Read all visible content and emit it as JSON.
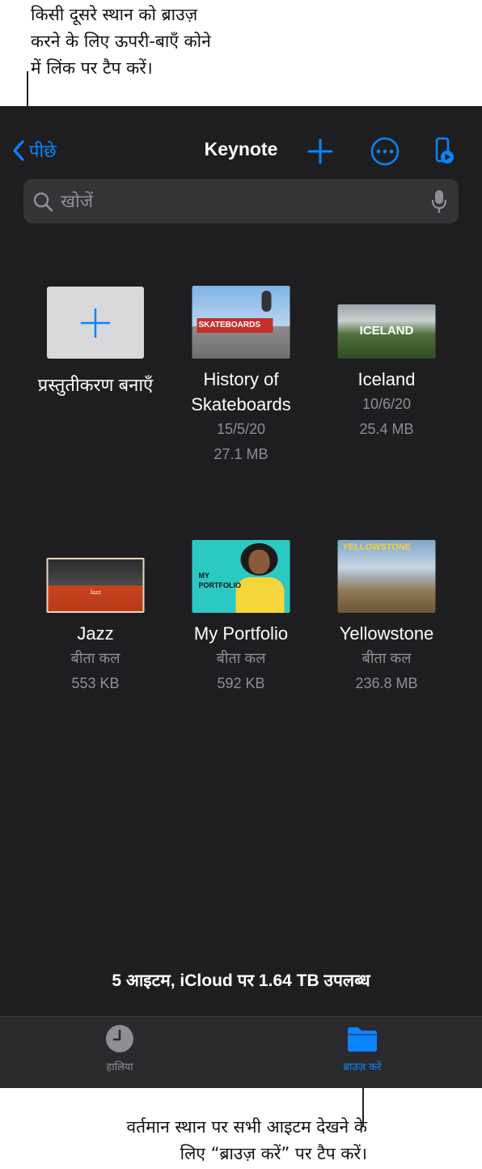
{
  "callouts": {
    "top": "किसी दूसरे स्थान को ब्राउज़\nकरने के लिए ऊपरी-बाएँ कोने\nमें लिंक पर टैप करें।",
    "bottom": "वर्तमान स्थान पर सभी आइटम देखने के\nलिए “ब्राउज़ करें” पर टैप करें।"
  },
  "nav": {
    "back_label": "पीछे",
    "title": "Keynote",
    "icons": [
      "chevron-left-icon",
      "plus-icon",
      "ellipsis-circle-icon",
      "remote-play-icon"
    ]
  },
  "search": {
    "placeholder": "खोजें"
  },
  "create": {
    "label": "प्रस्तुतीकरण बनाएँ"
  },
  "items": [
    {
      "name": "History of Skateboards",
      "date": "15/5/20",
      "size": "27.1 MB",
      "thumb_text": "SKATEBOARDS"
    },
    {
      "name": "Iceland",
      "date": "10/6/20",
      "size": "25.4 MB",
      "thumb_text": "ICELAND"
    },
    {
      "name": "Jazz",
      "date": "बीता कल",
      "size": "553 KB",
      "thumb_text": "Jazz"
    },
    {
      "name": "My Portfolio",
      "date": "बीता कल",
      "size": "592 KB",
      "thumb_text": "MY PORTFOLIO"
    },
    {
      "name": "Yellowstone",
      "date": "बीता कल",
      "size": "236.8 MB",
      "thumb_text": "YELLOWSTONE"
    }
  ],
  "status": "5 आइटम, iCloud पर 1.64 TB उपलब्ध",
  "tabs": {
    "recents": "हालिया",
    "browse": "ब्राउज़ करें"
  },
  "colors": {
    "accent": "#0a84ff",
    "background": "#1e1e20",
    "tab_bar": "#2a2a2c"
  }
}
